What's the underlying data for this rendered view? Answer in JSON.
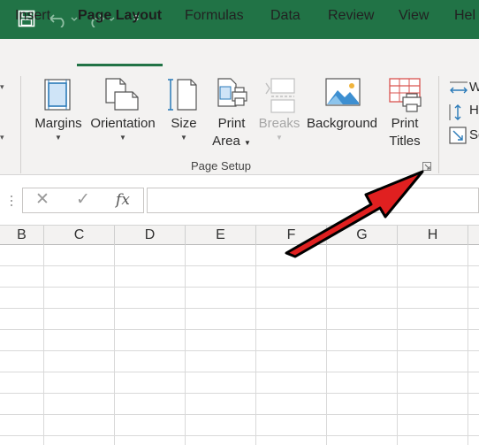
{
  "titlebar": {
    "icons": [
      "save-icon",
      "undo-icon",
      "redo-icon",
      "customize-toolbar-icon"
    ]
  },
  "tabs": [
    "Insert",
    "Page Layout",
    "Formulas",
    "Data",
    "Review",
    "View",
    "Hel"
  ],
  "active_tab": "Page Layout",
  "ribbon": {
    "margins": "Margins",
    "orientation": "Orientation",
    "size": "Size",
    "print_area_1": "Print",
    "print_area_2": "Area",
    "breaks": "Breaks",
    "background": "Background",
    "print_titles_1": "Print",
    "print_titles_2": "Titles",
    "group_label": "Page Setup",
    "side_items": [
      "W",
      "H",
      "Sc"
    ]
  },
  "formula_bar": {
    "cancel": "✕",
    "enter": "✓",
    "function": "fx",
    "value": ""
  },
  "columns": [
    "B",
    "C",
    "D",
    "E",
    "F",
    "G",
    "H"
  ],
  "colors": {
    "title_bar": "#217346",
    "arrow": "#e02020"
  }
}
